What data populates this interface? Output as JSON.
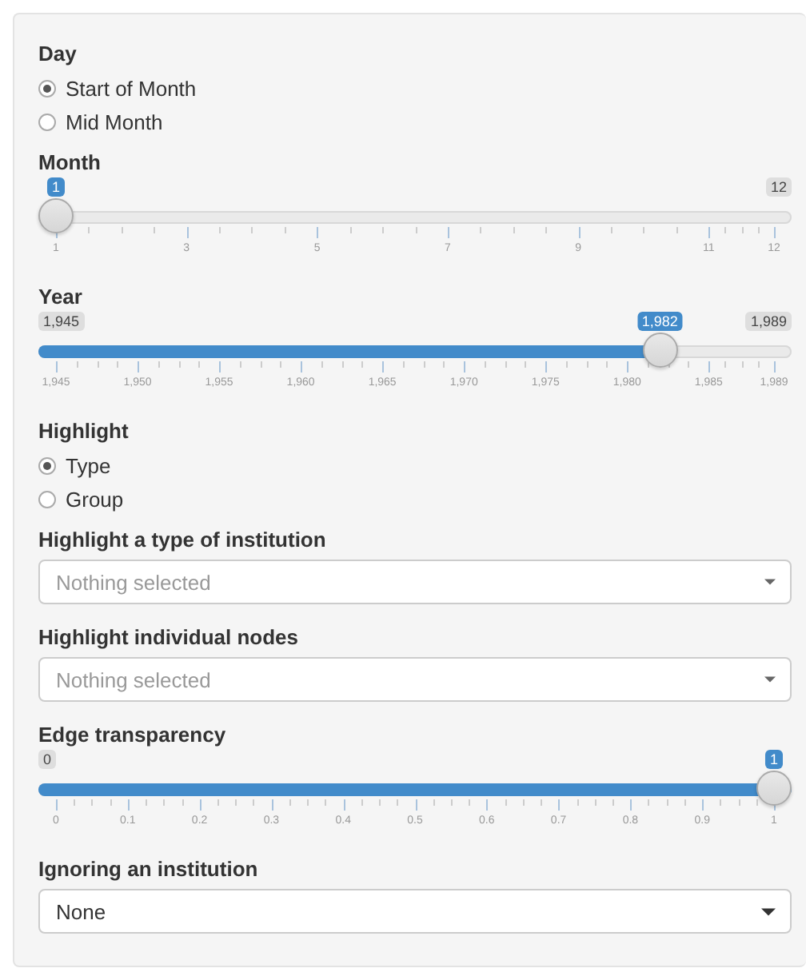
{
  "controls": [
    {
      "kind": "radio",
      "label": "Day",
      "options": [
        {
          "label": "Start of Month",
          "selected": true
        },
        {
          "label": "Mid Month",
          "selected": false
        }
      ]
    },
    {
      "kind": "slider",
      "label": "Month",
      "max_label": "12",
      "value_label": "1",
      "level": 0,
      "ticks": [
        "1",
        "3",
        "5",
        "7",
        "9",
        "11",
        "12"
      ]
    },
    {
      "kind": "slider",
      "label": "Year",
      "min_label": "1,945",
      "max_label": "1,989",
      "value_label": "1,982",
      "level": 0.841,
      "ticks": [
        "1,945",
        "1,950",
        "1,955",
        "1,960",
        "1,965",
        "1,970",
        "1,975",
        "1,980",
        "1,985",
        "1,989"
      ]
    },
    {
      "kind": "radio",
      "label": "Highlight",
      "options": [
        {
          "label": "Type",
          "selected": true
        },
        {
          "label": "Group",
          "selected": false
        }
      ]
    },
    {
      "kind": "multiselect",
      "label": "Highlight a type of institution",
      "placeholder": "Nothing selected"
    },
    {
      "kind": "multiselect",
      "label": "Highlight individual nodes",
      "placeholder": "Nothing selected"
    },
    {
      "kind": "slider",
      "label": "Edge transparency",
      "min_label": "0",
      "value_label": "1",
      "level": 1,
      "ticks": [
        "0",
        "0.1",
        "0.2",
        "0.3",
        "0.4",
        "0.5",
        "0.6",
        "0.7",
        "0.8",
        "0.9",
        "1"
      ]
    },
    {
      "kind": "select",
      "label": "Ignoring an institution",
      "value": "None"
    }
  ]
}
